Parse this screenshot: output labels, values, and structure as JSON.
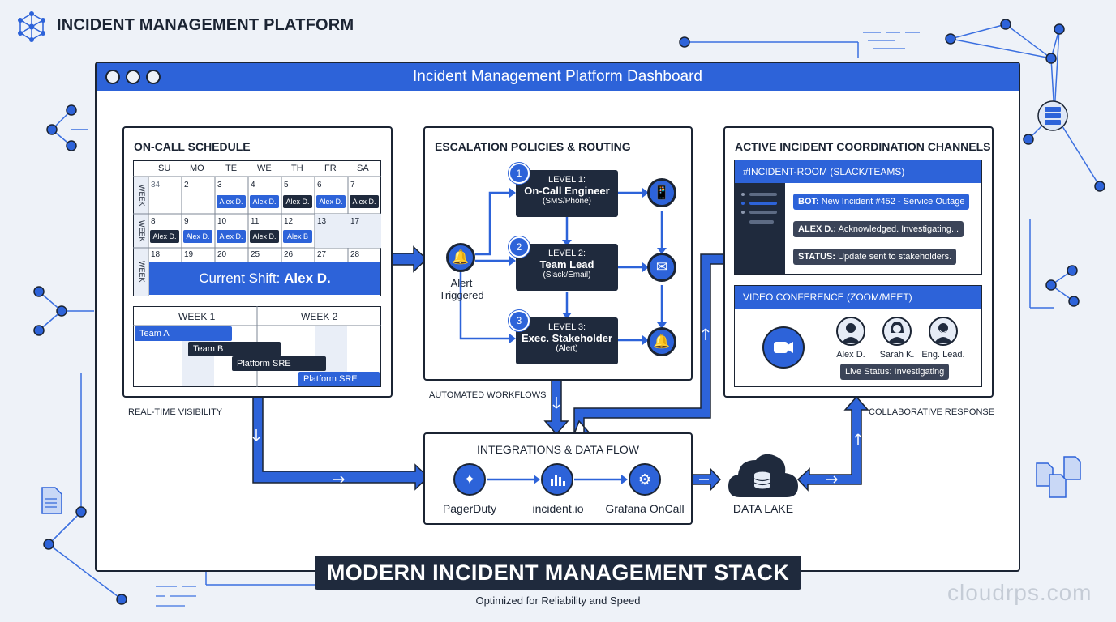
{
  "header": {
    "title": "INCIDENT MANAGEMENT PLATFORM",
    "logo_icon": "network-hexagon-icon"
  },
  "window": {
    "title": "Incident Management Platform Dashboard"
  },
  "oncall": {
    "title": "ON-CALL SCHEDULE",
    "days": [
      "SU",
      "MO",
      "TE",
      "WE",
      "TH",
      "FR",
      "SA"
    ],
    "week_label": "WEEK",
    "row1": {
      "nums": [
        "34",
        "2",
        "3",
        "4",
        "5",
        "6",
        "7"
      ],
      "pills": [
        "Alex D.",
        "Alex D.",
        "Alex D.",
        "Alex D.",
        "Alex D."
      ]
    },
    "row2": {
      "nums": [
        "8",
        "9",
        "10",
        "11",
        "12",
        "13",
        "17"
      ],
      "pills": [
        "Alex D.",
        "Alex D.",
        "Alex D.",
        "Alex D.",
        "Alex B"
      ]
    },
    "row3": {
      "nums": [
        "18",
        "19",
        "20",
        "25",
        "26",
        "27",
        "28"
      ]
    },
    "shift_prefix": "Current Shift:",
    "shift_name": "Alex D.",
    "gantt": {
      "week1": "WEEK 1",
      "week2": "WEEK 2",
      "bars": [
        "Team A",
        "Team B",
        "Platform SRE",
        "Platform SRE"
      ]
    },
    "caption": "REAL-TIME VISIBILITY"
  },
  "escalation": {
    "title": "ESCALATION POLICIES & ROUTING",
    "alert": "Alert\nTriggered",
    "alert_line1": "Alert",
    "alert_line2": "Triggered",
    "levels": [
      {
        "num": "1",
        "level": "LEVEL 1:",
        "name": "On-Call Engineer",
        "via": "(SMS/Phone)"
      },
      {
        "num": "2",
        "level": "LEVEL 2:",
        "name": "Team Lead",
        "via": "(Slack/Email)"
      },
      {
        "num": "3",
        "level": "LEVEL 3:",
        "name": "Exec. Stakeholder",
        "via": "(Alert)"
      }
    ],
    "caption": "AUTOMATED WORKFLOWS"
  },
  "channels": {
    "title": "ACTIVE INCIDENT COORDINATION CHANNELS",
    "room_title": "#INCIDENT-ROOM (SLACK/TEAMS)",
    "messages": [
      {
        "who": "BOT:",
        "text": "New Incident #452 - Service Outage"
      },
      {
        "who": "ALEX D.:",
        "text": "Acknowledged. Investigating..."
      },
      {
        "who": "STATUS:",
        "text": "Update sent to stakeholders."
      }
    ],
    "video_title": "VIDEO CONFERENCE (ZOOM/MEET)",
    "participants": [
      "Alex D.",
      "Sarah K.",
      "Eng. Lead."
    ],
    "live_status": "Live Status: Investigating",
    "caption": "COLLABORATIVE RESPONSE"
  },
  "integrations": {
    "title": "INTEGRATIONS & DATA FLOW",
    "tools": [
      "PagerDuty",
      "incident.io",
      "Grafana OnCall"
    ],
    "datalake": "DATA LAKE"
  },
  "banner": {
    "title": "MODERN INCIDENT MANAGEMENT STACK",
    "subtitle": "Optimized for Reliability and Speed"
  },
  "watermark": "cloudrps.com",
  "colors": {
    "accent": "#2d63d9",
    "dark": "#1f2a3d",
    "background": "#eef2f8"
  }
}
